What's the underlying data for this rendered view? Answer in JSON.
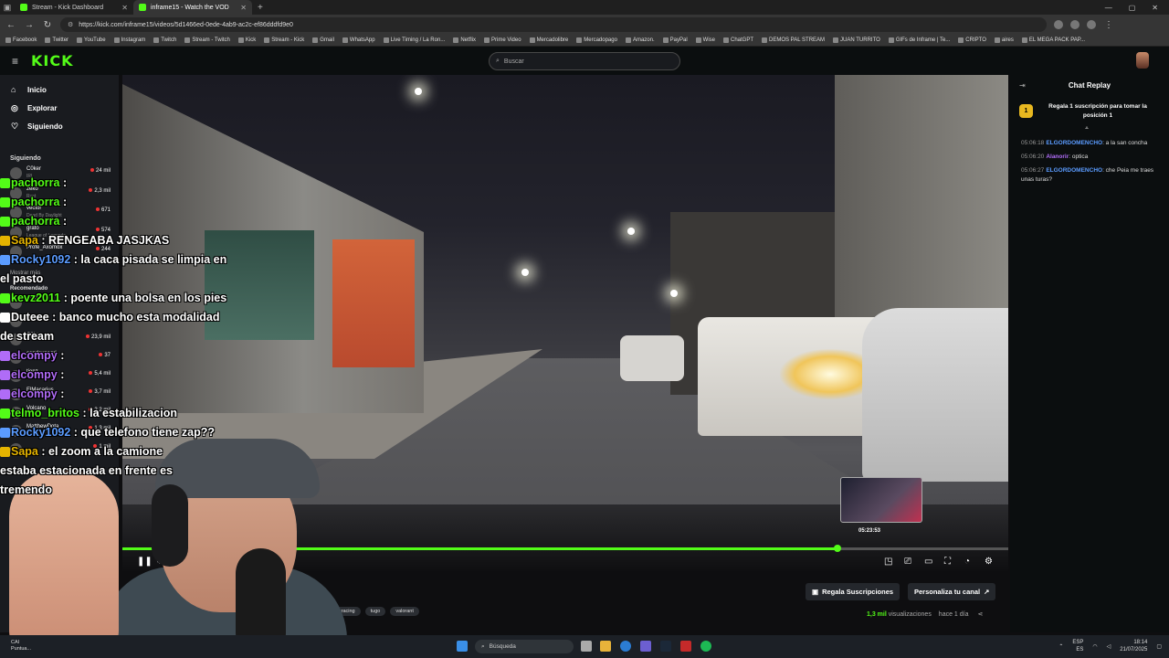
{
  "browser": {
    "tabs": [
      {
        "title": "Stream - Kick Dashboard",
        "active": false
      },
      {
        "title": "inframe15 - Watch the VOD",
        "active": true
      }
    ],
    "url": "https://kick.com/inframe15/videos/5d1466ed-0ede-4ab9-ac2c-ef86dddfd9e0",
    "bookmarks": [
      "Facebook",
      "Twitter",
      "YouTube",
      "Instagram",
      "Twitch",
      "Stream - Twitch",
      "Kick",
      "Stream - Kick",
      "Gmail",
      "WhatsApp",
      "Live Timing / La Ron...",
      "Netflix",
      "Prime Video",
      "Mercadolibre",
      "Mercadopago",
      "Amazon.",
      "PayPal",
      "Wise",
      "ChatGPT",
      "DEMOS PAL STREAM",
      "JUAN TURRITO",
      "GIFs de Inframe | Te...",
      "CRIPTO",
      "aires",
      "EL MEGA PACK PAP..."
    ]
  },
  "header": {
    "logo": "KICK",
    "search_placeholder": "Buscar"
  },
  "sidebar": {
    "nav": [
      {
        "label": "Inicio",
        "icon": "home-icon"
      },
      {
        "label": "Explorar",
        "icon": "compass-icon"
      },
      {
        "label": "Siguiendo",
        "icon": "heart-icon"
      }
    ],
    "following_title": "Siguiendo",
    "following": [
      {
        "name": "C0ker",
        "category": "IRL",
        "viewers": "24 mil"
      },
      {
        "name": "zeko",
        "category": "Rust",
        "viewers": "2,3 mil"
      },
      {
        "name": "vector",
        "category": "Dead By Daylight",
        "viewers": "671"
      },
      {
        "name": "grato",
        "category": "League of Legends",
        "viewers": "574"
      },
      {
        "name": "Profe_Axomox",
        "category": "",
        "viewers": "244"
      }
    ],
    "show_more": "Mostrar más",
    "recommended_title": "Recomendado",
    "recommended": [
      {
        "name": "Rust",
        "category": "",
        "viewers": ""
      },
      {
        "name": "Ciro",
        "category": "",
        "viewers": "588"
      },
      {
        "name": "C0ker",
        "category": "",
        "viewers": "23,9 mil"
      },
      {
        "name": "candexnegri",
        "category": "",
        "viewers": "37"
      },
      {
        "name": "tjenz",
        "category": "",
        "viewers": "5,4 mil"
      },
      {
        "name": "ElMacarius",
        "category": "",
        "viewers": "3,7 mil"
      },
      {
        "name": "Volcano",
        "category": "",
        "viewers": "2,2 mil"
      },
      {
        "name": "MatthewDota",
        "category": "",
        "viewers": "1,3 mil"
      },
      {
        "name": "",
        "category": "",
        "viewers": "1 mil"
      }
    ]
  },
  "overlay_chat": [
    {
      "user": "pachorra",
      "text": " :",
      "color": "#53fc18"
    },
    {
      "user": "pachorra",
      "text": " :",
      "color": "#53fc18"
    },
    {
      "user": "pachorra",
      "text": " :",
      "color": "#53fc18"
    },
    {
      "user": "Sapa",
      "text": " : RENGEABA JASJKAS",
      "color": "#e5b400"
    },
    {
      "user": "Rocky1092",
      "text": " : la caca pisada se limpia en",
      "color": "#5b9cff"
    },
    {
      "user": "",
      "text": "el pasto",
      "color": "#fff"
    },
    {
      "user": "kevz2011",
      "text": " : poente una bolsa en los pies",
      "color": "#53fc18"
    },
    {
      "user": "Duteee",
      "text": " : banco mucho esta modalidad",
      "color": "#fff"
    },
    {
      "user": "",
      "text": "de stream",
      "color": "#fff"
    },
    {
      "user": "elcompy",
      "text": " :",
      "color": "#b06cf7"
    },
    {
      "user": "elcompy",
      "text": " :",
      "color": "#b06cf7"
    },
    {
      "user": "elcompy",
      "text": " :",
      "color": "#b06cf7"
    },
    {
      "user": "telmo_britos",
      "text": " : la estabilizacion",
      "color": "#53fc18"
    },
    {
      "user": "Rocky1092",
      "text": " : que telefono tiene zap??",
      "color": "#5b9cff"
    },
    {
      "user": "Sapa",
      "text": " : el zoom a la camione",
      "color": "#e5b400"
    },
    {
      "user": "",
      "text": "estaba estacionada en frente es",
      "color": "#fff"
    },
    {
      "user": "",
      "text": "tremendo",
      "color": "#fff"
    }
  ],
  "player": {
    "progress_fraction": 0.807,
    "hover_time": "05:23:53"
  },
  "below": {
    "gift_button": "Regala Suscripciones",
    "customize_button": "Personaliza tu canal",
    "tags": [
      "o",
      "simracing",
      "tugo",
      "valorant"
    ],
    "views": "1,3 mil",
    "views_label": "visualizaciones",
    "ago": "hace 1 día"
  },
  "chat": {
    "title": "Chat Replay",
    "gift_text": "Regala 1 suscripción para tomar la posición 1",
    "gift_badge": "1",
    "messages": [
      {
        "time": "05:06:18",
        "user": "ELGORDOMENCHO",
        "text": ": a la san concha",
        "color": "u1"
      },
      {
        "time": "05:06:20",
        "user": "Alanorir",
        "text": ": optica",
        "color": "u2"
      },
      {
        "time": "05:06:27",
        "user": "ELGORDOMENCHO",
        "text": ": che Peia me traes unas turas?",
        "color": "u1"
      }
    ]
  },
  "taskbar": {
    "search": "Búsqueda",
    "weather_line1": "CAI",
    "weather_line2": "Puntua...",
    "lang1": "ESP",
    "lang2": "ES",
    "time": "18:14",
    "date": "21/07/2025"
  },
  "colors": {
    "accent": "#53fc18",
    "bg": "#0e0e10"
  }
}
